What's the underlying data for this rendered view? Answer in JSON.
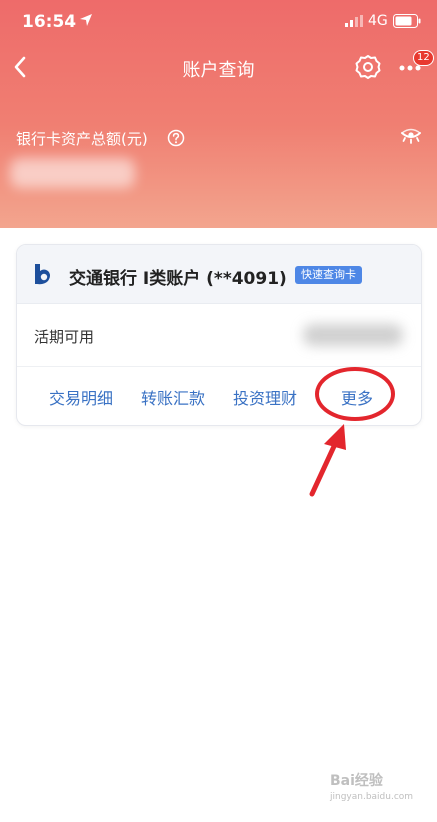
{
  "status_bar": {
    "time": "16:54",
    "network": "4G"
  },
  "nav": {
    "title": "账户查询",
    "badge_count": "12"
  },
  "asset": {
    "label": "银行卡资产总额(元)"
  },
  "card": {
    "bank_name": "交通银行 I类账户 (**4091)",
    "tag": "快速查询卡",
    "balance_label": "活期可用",
    "actions": [
      "交易明细",
      "转账汇款",
      "投资理财",
      "更多"
    ]
  },
  "watermark": {
    "main": "Bai经验",
    "sub": "jingyan.baidu.com"
  },
  "colors": {
    "header_top": "#ee6b6a",
    "header_bottom": "#f3a58e",
    "action_blue": "#3a72c4",
    "annotation_red": "#e3262d"
  }
}
